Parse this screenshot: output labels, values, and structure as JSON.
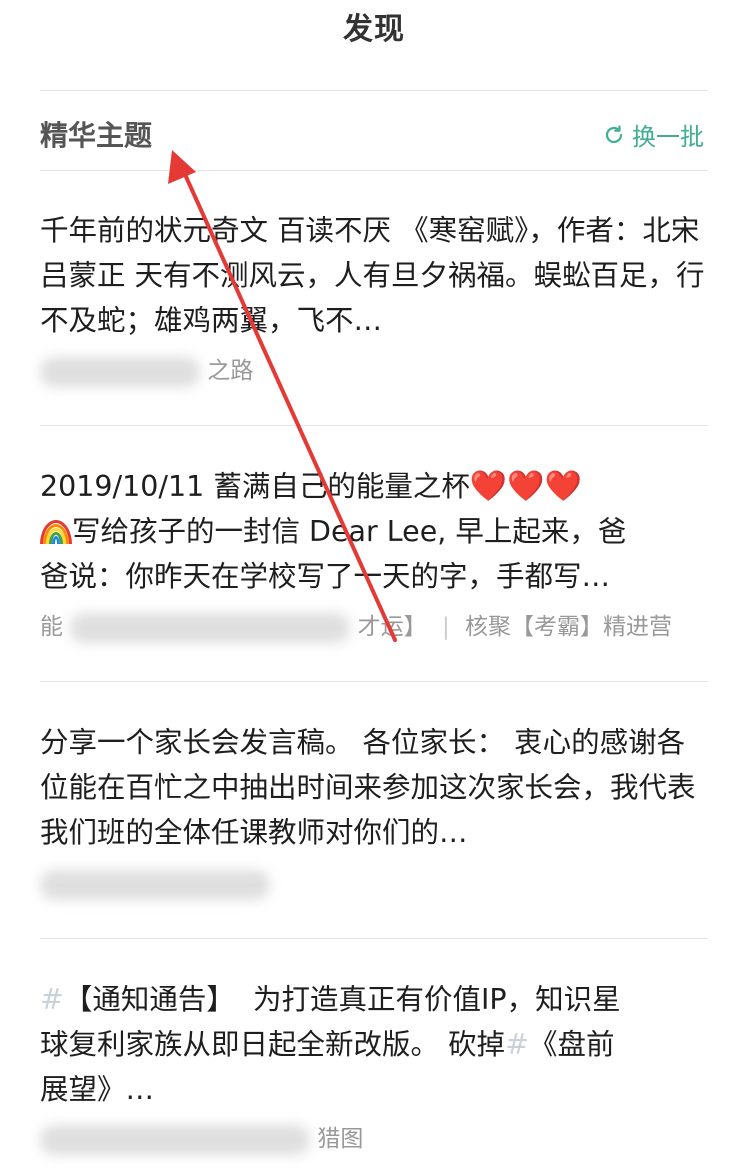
{
  "header": {
    "title": "发现"
  },
  "section": {
    "title": "精华主题",
    "refresh_label": "换一批",
    "refresh_icon": "refresh-icon"
  },
  "posts": [
    {
      "text": "千年前的状元奇文 百读不厌 《寒窑赋》，作者：北宋吕蒙正 天有不测风云，人有旦夕祸福。蜈蚣百足，行不及蛇；雄鸡两翼，飞不…",
      "meta_suffix": "之路"
    },
    {
      "line1_prefix": "2019/10/11   蓄满自己的能量之杯",
      "line2": "写给孩子的一封信 Dear Lee, 早上起来，爸",
      "line3": "爸说：你昨天在学校写了一天的字，手都写…",
      "meta_prefix": "能",
      "meta_mid": "才运】",
      "meta_sep": "|",
      "meta_group": "核聚【考霸】精进营",
      "hearts": "❤️",
      "rainbow_icon": "rainbow-icon"
    },
    {
      "text": "分享一个家长会发言稿。 各位家长： 衷心的感谢各位能在百忙之中抽出时间来参加这次家长会，我代表我们班的全体任课教师对你们的…"
    },
    {
      "tag1": "#",
      "tag1_text": "【通知通告】",
      "line1_rest": "为打造真正有价值IP，知识星",
      "line2": "球复利家族从即日起全新改版。 砍掉",
      "tag2": "#",
      "tag2_text": "《盘前",
      "line3": "展望》…",
      "meta_suffix": "猎图"
    }
  ],
  "colors": {
    "accent": "#3fae92",
    "arrow": "#e53935",
    "heart": "#e2202b"
  }
}
